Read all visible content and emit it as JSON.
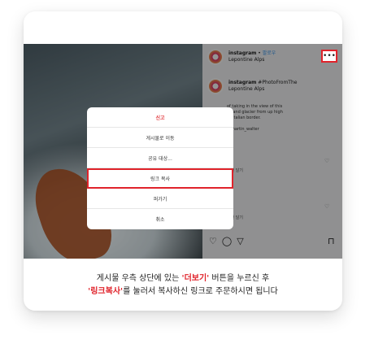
{
  "post": {
    "account_name": "instagram",
    "follow_label": "팔로우",
    "location": "Lepontine Alps",
    "comment_account": "instagram",
    "comment_text": "#PhotoFromThe",
    "comment_location": "Lepontine Alps",
    "caption_lines": [
      "of taking in the view of this",
      "ns and glacier from up high",
      "ss-Italian border.",
      "@martin_walter"
    ],
    "like_lines": [
      "일",
      "답글 달기",
      "답글 달기"
    ]
  },
  "modal": {
    "items": [
      {
        "label": "신고"
      },
      {
        "label": "게시물로 이동"
      },
      {
        "label": "공유 대상..."
      },
      {
        "label": "링크 복사"
      },
      {
        "label": "퍼가기"
      },
      {
        "label": "취소"
      }
    ]
  },
  "instructions": {
    "line1_prefix": "게시물 우측 상단에 있는 ",
    "line1_accent": "'더보기'",
    "line1_suffix": " 버튼을 누르신 후",
    "line2_accent": "'링크복사'",
    "line2_suffix": "를 눌러서 복사하신 링크로 주문하시면 됩니다"
  },
  "colors": {
    "accent": "#e0232b",
    "report": "#e23a3f"
  },
  "icons": {
    "more": "more-horizontal-icon",
    "heart": "heart-icon",
    "comment": "comment-icon",
    "share": "share-icon",
    "bookmark": "bookmark-icon"
  }
}
